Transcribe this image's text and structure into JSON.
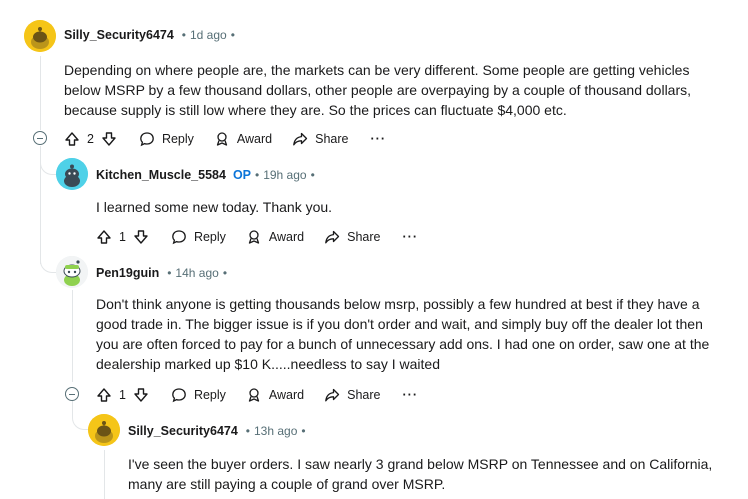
{
  "comments": [
    {
      "username": "Silly_Security6474",
      "op_badge": "",
      "time": "1d ago",
      "body": "Depending on where people are, the markets can be very different. Some people are getting vehicles below MSRP by a few thousand dollars, other people are overpaying by a couple of thousand dollars, because supply is still low where they are. So the prices can fluctuate $4,000 etc.",
      "votes": "2",
      "reply_label": "Reply",
      "award_label": "Award",
      "share_label": "Share",
      "more_label": "···"
    },
    {
      "username": "Kitchen_Muscle_5584",
      "op_badge": "OP",
      "time": "19h ago",
      "body": "I learned some new today. Thank you.",
      "votes": "1",
      "reply_label": "Reply",
      "award_label": "Award",
      "share_label": "Share",
      "more_label": "···"
    },
    {
      "username": "Pen19guin",
      "op_badge": "",
      "time": "14h ago",
      "body": "Don't think anyone is getting thousands below msrp, possibly a few hundred at best if they have a good trade in. The bigger issue is if you don't order and wait, and simply buy off the dealer lot then you are often forced to pay for a bunch of unnecessary add ons. I had one on order, saw one at the dealership marked up $10 K.....needless to say I waited",
      "votes": "1",
      "reply_label": "Reply",
      "award_label": "Award",
      "share_label": "Share",
      "more_label": "···"
    },
    {
      "username": "Silly_Security6474",
      "op_badge": "",
      "time": "13h ago",
      "body": "I've seen the buyer orders. I saw nearly 3 grand below MSRP on Tennessee and on California, many are still paying a couple of grand over MSRP."
    }
  ],
  "colors": {
    "text": "#1a1a1b",
    "meta": "#576f76",
    "op": "#0a74d9",
    "snoo_yellow": "#f5c518",
    "snoo_teal": "#4fd1e8",
    "thread_line": "#e3e6e8"
  }
}
